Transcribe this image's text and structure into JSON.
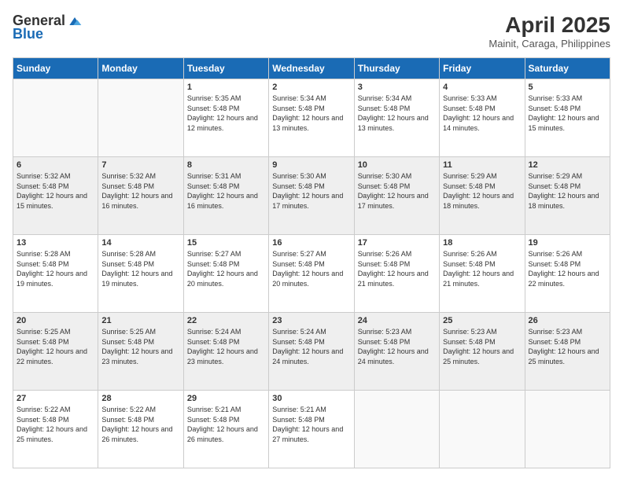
{
  "logo": {
    "general": "General",
    "blue": "Blue"
  },
  "header": {
    "title": "April 2025",
    "subtitle": "Mainit, Caraga, Philippines"
  },
  "weekdays": [
    "Sunday",
    "Monday",
    "Tuesday",
    "Wednesday",
    "Thursday",
    "Friday",
    "Saturday"
  ],
  "weeks": [
    [
      {
        "day": "",
        "sunrise": "",
        "sunset": "",
        "daylight": ""
      },
      {
        "day": "",
        "sunrise": "",
        "sunset": "",
        "daylight": ""
      },
      {
        "day": "1",
        "sunrise": "Sunrise: 5:35 AM",
        "sunset": "Sunset: 5:48 PM",
        "daylight": "Daylight: 12 hours and 12 minutes."
      },
      {
        "day": "2",
        "sunrise": "Sunrise: 5:34 AM",
        "sunset": "Sunset: 5:48 PM",
        "daylight": "Daylight: 12 hours and 13 minutes."
      },
      {
        "day": "3",
        "sunrise": "Sunrise: 5:34 AM",
        "sunset": "Sunset: 5:48 PM",
        "daylight": "Daylight: 12 hours and 13 minutes."
      },
      {
        "day": "4",
        "sunrise": "Sunrise: 5:33 AM",
        "sunset": "Sunset: 5:48 PM",
        "daylight": "Daylight: 12 hours and 14 minutes."
      },
      {
        "day": "5",
        "sunrise": "Sunrise: 5:33 AM",
        "sunset": "Sunset: 5:48 PM",
        "daylight": "Daylight: 12 hours and 15 minutes."
      }
    ],
    [
      {
        "day": "6",
        "sunrise": "Sunrise: 5:32 AM",
        "sunset": "Sunset: 5:48 PM",
        "daylight": "Daylight: 12 hours and 15 minutes."
      },
      {
        "day": "7",
        "sunrise": "Sunrise: 5:32 AM",
        "sunset": "Sunset: 5:48 PM",
        "daylight": "Daylight: 12 hours and 16 minutes."
      },
      {
        "day": "8",
        "sunrise": "Sunrise: 5:31 AM",
        "sunset": "Sunset: 5:48 PM",
        "daylight": "Daylight: 12 hours and 16 minutes."
      },
      {
        "day": "9",
        "sunrise": "Sunrise: 5:30 AM",
        "sunset": "Sunset: 5:48 PM",
        "daylight": "Daylight: 12 hours and 17 minutes."
      },
      {
        "day": "10",
        "sunrise": "Sunrise: 5:30 AM",
        "sunset": "Sunset: 5:48 PM",
        "daylight": "Daylight: 12 hours and 17 minutes."
      },
      {
        "day": "11",
        "sunrise": "Sunrise: 5:29 AM",
        "sunset": "Sunset: 5:48 PM",
        "daylight": "Daylight: 12 hours and 18 minutes."
      },
      {
        "day": "12",
        "sunrise": "Sunrise: 5:29 AM",
        "sunset": "Sunset: 5:48 PM",
        "daylight": "Daylight: 12 hours and 18 minutes."
      }
    ],
    [
      {
        "day": "13",
        "sunrise": "Sunrise: 5:28 AM",
        "sunset": "Sunset: 5:48 PM",
        "daylight": "Daylight: 12 hours and 19 minutes."
      },
      {
        "day": "14",
        "sunrise": "Sunrise: 5:28 AM",
        "sunset": "Sunset: 5:48 PM",
        "daylight": "Daylight: 12 hours and 19 minutes."
      },
      {
        "day": "15",
        "sunrise": "Sunrise: 5:27 AM",
        "sunset": "Sunset: 5:48 PM",
        "daylight": "Daylight: 12 hours and 20 minutes."
      },
      {
        "day": "16",
        "sunrise": "Sunrise: 5:27 AM",
        "sunset": "Sunset: 5:48 PM",
        "daylight": "Daylight: 12 hours and 20 minutes."
      },
      {
        "day": "17",
        "sunrise": "Sunrise: 5:26 AM",
        "sunset": "Sunset: 5:48 PM",
        "daylight": "Daylight: 12 hours and 21 minutes."
      },
      {
        "day": "18",
        "sunrise": "Sunrise: 5:26 AM",
        "sunset": "Sunset: 5:48 PM",
        "daylight": "Daylight: 12 hours and 21 minutes."
      },
      {
        "day": "19",
        "sunrise": "Sunrise: 5:26 AM",
        "sunset": "Sunset: 5:48 PM",
        "daylight": "Daylight: 12 hours and 22 minutes."
      }
    ],
    [
      {
        "day": "20",
        "sunrise": "Sunrise: 5:25 AM",
        "sunset": "Sunset: 5:48 PM",
        "daylight": "Daylight: 12 hours and 22 minutes."
      },
      {
        "day": "21",
        "sunrise": "Sunrise: 5:25 AM",
        "sunset": "Sunset: 5:48 PM",
        "daylight": "Daylight: 12 hours and 23 minutes."
      },
      {
        "day": "22",
        "sunrise": "Sunrise: 5:24 AM",
        "sunset": "Sunset: 5:48 PM",
        "daylight": "Daylight: 12 hours and 23 minutes."
      },
      {
        "day": "23",
        "sunrise": "Sunrise: 5:24 AM",
        "sunset": "Sunset: 5:48 PM",
        "daylight": "Daylight: 12 hours and 24 minutes."
      },
      {
        "day": "24",
        "sunrise": "Sunrise: 5:23 AM",
        "sunset": "Sunset: 5:48 PM",
        "daylight": "Daylight: 12 hours and 24 minutes."
      },
      {
        "day": "25",
        "sunrise": "Sunrise: 5:23 AM",
        "sunset": "Sunset: 5:48 PM",
        "daylight": "Daylight: 12 hours and 25 minutes."
      },
      {
        "day": "26",
        "sunrise": "Sunrise: 5:23 AM",
        "sunset": "Sunset: 5:48 PM",
        "daylight": "Daylight: 12 hours and 25 minutes."
      }
    ],
    [
      {
        "day": "27",
        "sunrise": "Sunrise: 5:22 AM",
        "sunset": "Sunset: 5:48 PM",
        "daylight": "Daylight: 12 hours and 25 minutes."
      },
      {
        "day": "28",
        "sunrise": "Sunrise: 5:22 AM",
        "sunset": "Sunset: 5:48 PM",
        "daylight": "Daylight: 12 hours and 26 minutes."
      },
      {
        "day": "29",
        "sunrise": "Sunrise: 5:21 AM",
        "sunset": "Sunset: 5:48 PM",
        "daylight": "Daylight: 12 hours and 26 minutes."
      },
      {
        "day": "30",
        "sunrise": "Sunrise: 5:21 AM",
        "sunset": "Sunset: 5:48 PM",
        "daylight": "Daylight: 12 hours and 27 minutes."
      },
      {
        "day": "",
        "sunrise": "",
        "sunset": "",
        "daylight": ""
      },
      {
        "day": "",
        "sunrise": "",
        "sunset": "",
        "daylight": ""
      },
      {
        "day": "",
        "sunrise": "",
        "sunset": "",
        "daylight": ""
      }
    ]
  ]
}
